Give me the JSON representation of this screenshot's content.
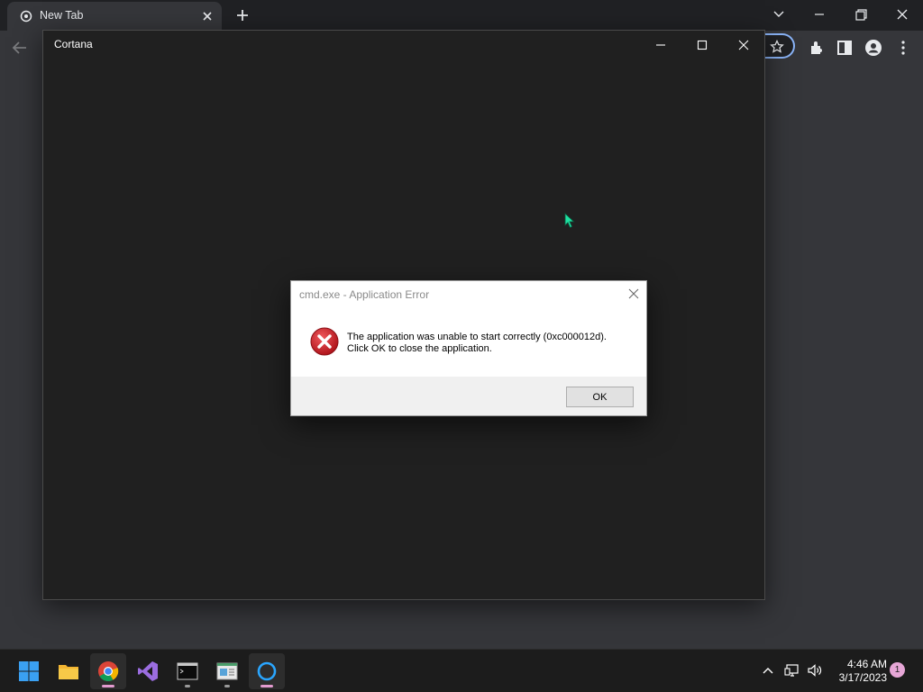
{
  "browser": {
    "tab_title": "New Tab"
  },
  "cortana": {
    "title": "Cortana"
  },
  "dialog": {
    "title": "cmd.exe - Application Error",
    "message_line1": "The application was unable to start correctly (0xc000012d).",
    "message_line2": "Click OK to close the application.",
    "ok_label": "OK",
    "icon": "error-icon"
  },
  "taskbar": {
    "apps": [
      "start",
      "file-explorer",
      "chrome",
      "visual-studio",
      "terminal",
      "store-app",
      "cortana"
    ],
    "time": "4:46 AM",
    "date": "3/17/2023",
    "notification_count": "1"
  },
  "colors": {
    "cortana_bg": "#202020",
    "chrome_dark": "#35363a",
    "omnibox_focus": "#8ab4f8",
    "error_red": "#c4161c",
    "cortana_ring": "#2aa6ff"
  }
}
